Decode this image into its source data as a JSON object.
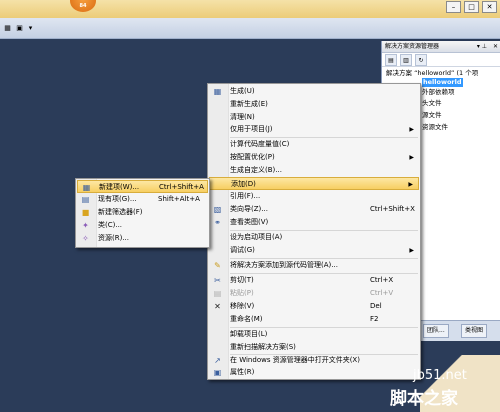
{
  "titlebar": {
    "orb_badge": "84",
    "buttons": [
      "–",
      "□",
      "✕"
    ]
  },
  "toolbar": {
    "icons": [
      "grid-icon",
      "window-icon",
      "dropdown-arrow-icon"
    ]
  },
  "solution_explorer": {
    "title": "解决方案资源管理器",
    "pin": "▾ ⊥",
    "close": "✕",
    "tree": [
      {
        "label": "解决方案 “helloworld” (1 个项",
        "selected": false
      },
      {
        "label": "helloworld",
        "selected": true
      },
      {
        "label": "外部依赖项",
        "selected": false
      },
      {
        "label": "头文件",
        "selected": false
      },
      {
        "label": "源文件",
        "selected": false
      },
      {
        "label": "资源文件",
        "selected": false
      }
    ],
    "tabs": [
      "团队...",
      "类视图"
    ]
  },
  "main_menu": {
    "items": [
      {
        "label": "生成(U)",
        "shortcut": "",
        "icon": "build-icon"
      },
      {
        "label": "重新生成(E)",
        "shortcut": ""
      },
      {
        "label": "清理(N)",
        "shortcut": ""
      },
      {
        "label": "仅用于项目(J)",
        "shortcut": "",
        "submenu": true
      },
      {
        "label": "计算代码度量值(C)",
        "shortcut": ""
      },
      {
        "label": "按配置优化(P)",
        "shortcut": "",
        "submenu": true
      },
      {
        "label": "生成自定义(B)...",
        "shortcut": ""
      },
      {
        "label": "添加(D)",
        "shortcut": "",
        "submenu": true,
        "highlighted": true
      },
      {
        "label": "引用(F)...",
        "shortcut": ""
      },
      {
        "label": "类向导(Z)...",
        "shortcut": "Ctrl+Shift+X",
        "icon": "class-wizard-icon"
      },
      {
        "label": "查看类图(V)",
        "shortcut": "",
        "icon": "class-diagram-icon"
      },
      {
        "label": "设为启动项目(A)",
        "shortcut": ""
      },
      {
        "label": "调试(G)",
        "shortcut": "",
        "submenu": true
      },
      {
        "label": "将解决方案添加到源代码管理(A)...",
        "shortcut": "",
        "icon": "source-control-icon"
      },
      {
        "label": "剪切(T)",
        "shortcut": "Ctrl+X",
        "icon": "cut-icon"
      },
      {
        "label": "粘贴(P)",
        "shortcut": "Ctrl+V",
        "icon": "paste-icon",
        "disabled": true
      },
      {
        "label": "移除(V)",
        "shortcut": "Del",
        "icon": "remove-icon"
      },
      {
        "label": "重命名(M)",
        "shortcut": "F2"
      },
      {
        "label": "卸载项目(L)",
        "shortcut": ""
      },
      {
        "label": "重新扫描解决方案(S)",
        "shortcut": ""
      },
      {
        "label": "在 Windows 资源管理器中打开文件夹(X)",
        "shortcut": "",
        "icon": "open-folder-icon"
      },
      {
        "label": "属性(R)",
        "shortcut": "",
        "icon": "properties-icon"
      }
    ]
  },
  "add_submenu": {
    "items": [
      {
        "label": "新建项(W)...",
        "shortcut": "Ctrl+Shift+A",
        "icon": "new-item-icon",
        "highlighted": true
      },
      {
        "label": "现有项(G)...",
        "shortcut": "Shift+Alt+A",
        "icon": "existing-item-icon"
      },
      {
        "label": "新建筛选器(F)",
        "shortcut": "",
        "icon": "new-filter-icon"
      },
      {
        "label": "类(C)...",
        "shortcut": "",
        "icon": "class-icon"
      },
      {
        "label": "资源(R)...",
        "shortcut": "",
        "icon": "resource-icon"
      }
    ]
  },
  "watermark": {
    "site": "jb51.net",
    "name": "脚本之家"
  }
}
